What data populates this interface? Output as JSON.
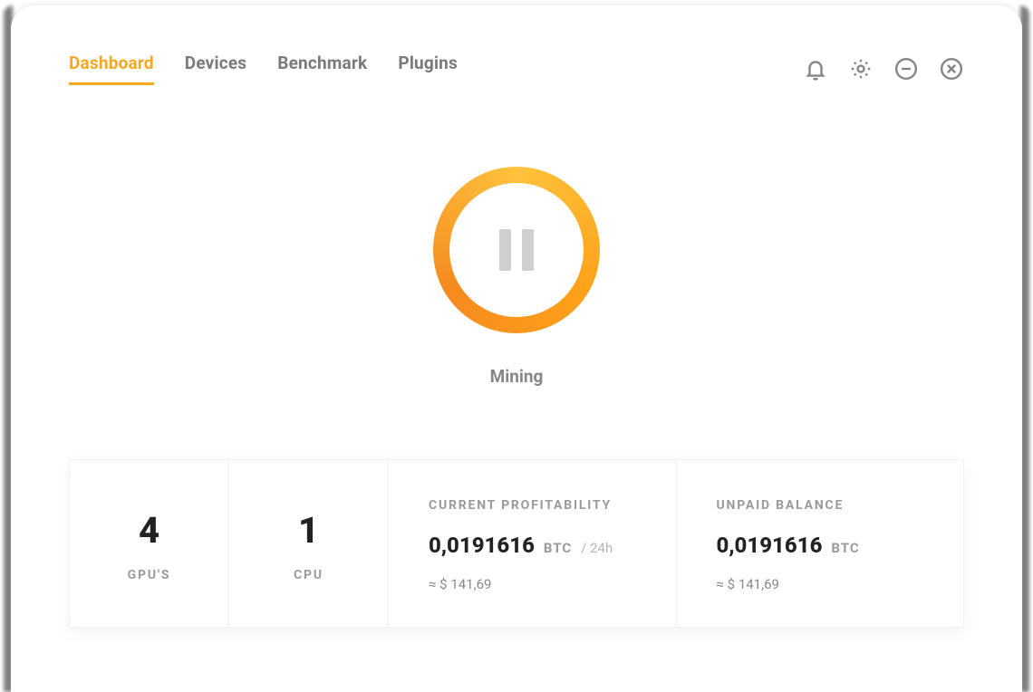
{
  "nav": {
    "tabs": [
      {
        "label": "Dashboard",
        "active": true
      },
      {
        "label": "Devices",
        "active": false
      },
      {
        "label": "Benchmark",
        "active": false
      },
      {
        "label": "Plugins",
        "active": false
      }
    ],
    "icons": [
      "bell",
      "gear",
      "minimize",
      "close"
    ]
  },
  "mining": {
    "state_icon": "pause",
    "status_label": "Mining"
  },
  "stats": {
    "gpus": {
      "count": "4",
      "label": "GPU'S"
    },
    "cpu": {
      "count": "1",
      "label": "CPU"
    },
    "profitability": {
      "title": "CURRENT PROFITABILITY",
      "amount": "0,0191616",
      "unit": "BTC",
      "per": "/ 24h",
      "approx": "≈ $ 141,69"
    },
    "balance": {
      "title": "UNPAID BALANCE",
      "amount": "0,0191616",
      "unit": "BTC",
      "approx": "≈ $ 141,69"
    }
  },
  "colors": {
    "accent": "#f6a821"
  }
}
